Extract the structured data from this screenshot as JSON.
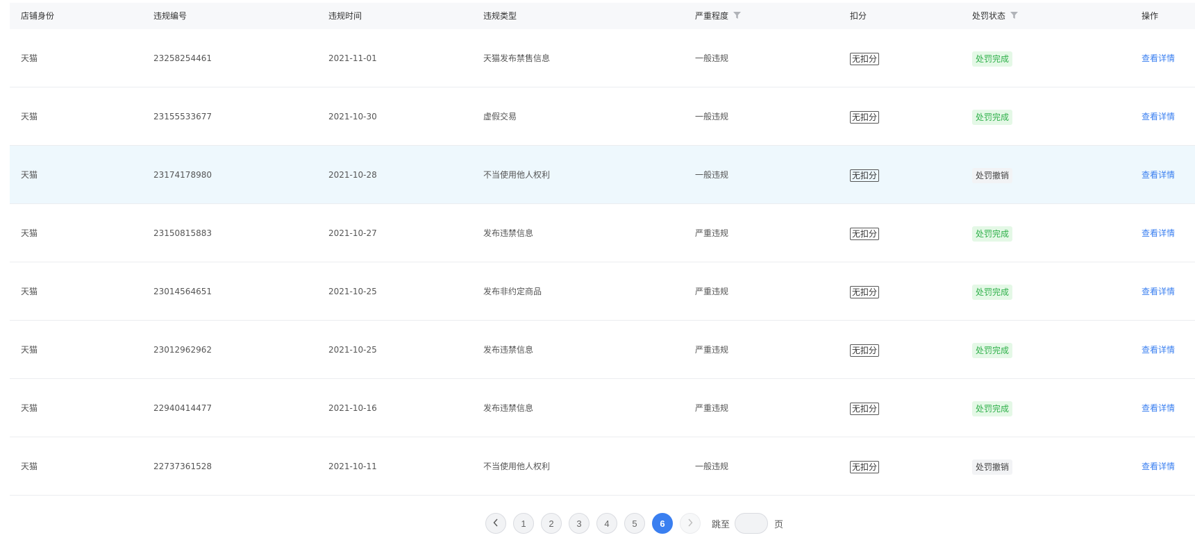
{
  "table": {
    "columns": [
      "店铺身份",
      "违规编号",
      "违规时间",
      "违规类型",
      "严重程度",
      "扣分",
      "处罚状态",
      "操作"
    ],
    "filter_icon": "filter-funnel-icon",
    "rows": [
      {
        "shop": "天猫",
        "id": "23258254461",
        "date": "2021-11-01",
        "type": "天猫发布禁售信息",
        "severity": "一般违规",
        "score": "无扣分",
        "status": "处罚完成",
        "action": "查看详情"
      },
      {
        "shop": "天猫",
        "id": "23155533677",
        "date": "2021-10-30",
        "type": "虚假交易",
        "severity": "一般违规",
        "score": "无扣分",
        "status": "处罚完成",
        "action": "查看详情"
      },
      {
        "shop": "天猫",
        "id": "23174178980",
        "date": "2021-10-28",
        "type": "不当使用他人权利",
        "severity": "一般违规",
        "score": "无扣分",
        "status": "处罚撤销",
        "action": "查看详情"
      },
      {
        "shop": "天猫",
        "id": "23150815883",
        "date": "2021-10-27",
        "type": "发布违禁信息",
        "severity": "严重违规",
        "score": "无扣分",
        "status": "处罚完成",
        "action": "查看详情"
      },
      {
        "shop": "天猫",
        "id": "23014564651",
        "date": "2021-10-25",
        "type": "发布非约定商品",
        "severity": "严重违规",
        "score": "无扣分",
        "status": "处罚完成",
        "action": "查看详情"
      },
      {
        "shop": "天猫",
        "id": "23012962962",
        "date": "2021-10-25",
        "type": "发布违禁信息",
        "severity": "严重违规",
        "score": "无扣分",
        "status": "处罚完成",
        "action": "查看详情"
      },
      {
        "shop": "天猫",
        "id": "22940414477",
        "date": "2021-10-16",
        "type": "发布违禁信息",
        "severity": "严重违规",
        "score": "无扣分",
        "status": "处罚完成",
        "action": "查看详情"
      },
      {
        "shop": "天猫",
        "id": "22737361528",
        "date": "2021-10-11",
        "type": "不当使用他人权利",
        "severity": "一般违规",
        "score": "无扣分",
        "status": "处罚撤销",
        "action": "查看详情"
      }
    ]
  },
  "colors": {
    "accent": "#3a7ff0",
    "status_done_text": "#2fb04a",
    "status_done_bg": "#e4f8e6",
    "status_revoked_bg": "#f2f3f5",
    "row_highlight": "#eef8fd"
  },
  "pagination": {
    "prev_icon": "chevron-left-icon",
    "next_icon": "chevron-right-icon",
    "pages": [
      "1",
      "2",
      "3",
      "4",
      "5",
      "6"
    ],
    "current": "6",
    "jump_label": "跳至",
    "jump_value": "",
    "page_suffix": "页"
  }
}
